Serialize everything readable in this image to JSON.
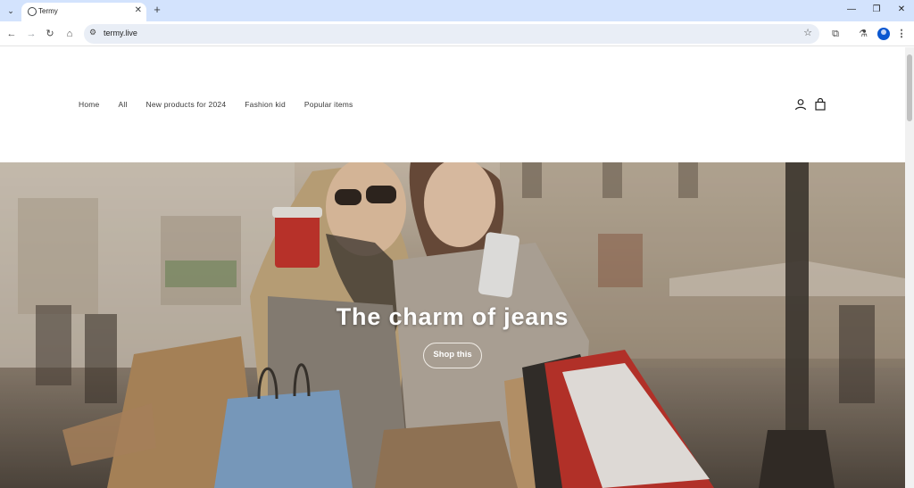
{
  "browser": {
    "tab_title": "Termy",
    "url": "termy.live",
    "icons": {
      "tab_search": "chevron-down-icon",
      "favicon": "globe-icon",
      "tab_close": "close-icon",
      "new_tab": "plus-icon",
      "back": "arrow-left-icon",
      "forward": "arrow-right-icon",
      "reload": "reload-icon",
      "home": "home-icon",
      "site_info": "tune-icon",
      "bookmark": "star-icon",
      "extensions": "puzzle-icon",
      "labs": "flask-icon",
      "profile": "avatar-icon",
      "menu": "kebab-menu-icon",
      "minimize": "minimize-icon",
      "restore": "restore-icon",
      "close": "close-window-icon"
    }
  },
  "site": {
    "nav": [
      "Home",
      "All",
      "New products for 2024",
      "Fashion kid",
      "Popular items"
    ],
    "header_icons": [
      "account-icon",
      "cart-icon"
    ],
    "hero": {
      "title": "The charm of jeans",
      "button_label": "Shop this"
    }
  },
  "colors": {
    "tabbar_bg": "#d3e3fd",
    "omnibox_bg": "#e9eef6",
    "hero_tint": "#7d7266"
  }
}
